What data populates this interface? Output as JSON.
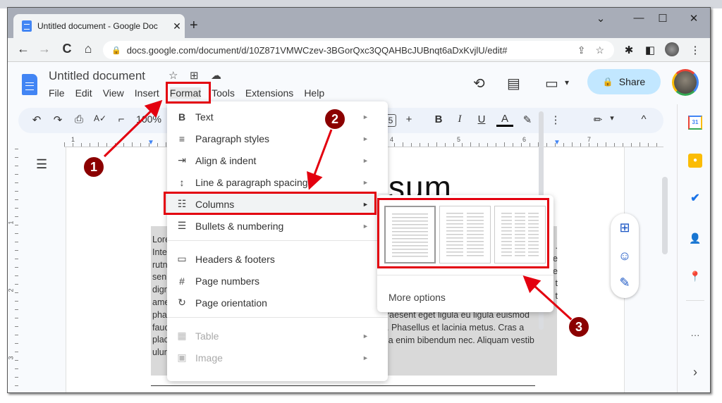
{
  "browser": {
    "tab_title": "Untitled document - Google Doc",
    "tab_close": "✕",
    "new_tab": "+",
    "window_controls": {
      "tab_search": "⌄",
      "minimize": "—",
      "maximize": "☐",
      "close": "✕"
    },
    "nav": {
      "back": "←",
      "forward": "→",
      "reload": "C",
      "home": "⌂"
    },
    "url": "docs.google.com/document/d/10Z871VMWCzev-3BGorQxc3QQAHBcJUBnqt6aDxKvjlU/edit#",
    "omnibox_icons": {
      "share": "⇪",
      "bookmark": "☆"
    },
    "extension_icons": {
      "extensions": "✱",
      "side_panel": "◧",
      "menu": "⋮"
    }
  },
  "docs": {
    "title": "Untitled document",
    "title_icons": {
      "star": "☆",
      "move": "⊞",
      "cloud": "☁"
    },
    "menu": [
      "File",
      "Edit",
      "View",
      "Insert",
      "Format",
      "Tools",
      "Extensions",
      "Help"
    ],
    "header_icons": {
      "history": "⟲",
      "comments": "▤",
      "meet": "▭",
      "meet_caret": "▾"
    },
    "share_label": "Share",
    "share_icon": "🔒",
    "toolbar": {
      "undo": "↶",
      "redo": "↷",
      "print": "⎙",
      "spellcheck": "A✓",
      "paint_format": "⌐",
      "zoom": "100%",
      "font_size": "5",
      "plus": "+",
      "bold": "B",
      "italic": "I",
      "underline": "U",
      "text_color": "A",
      "highlight": "✎",
      "more": "⋮",
      "editing_mode": "✏",
      "editing_caret": "▾",
      "collapse": "^"
    },
    "ruler_labels": [
      "1",
      "4",
      "5",
      "6",
      "7"
    ],
    "vruler_labels": [
      "1",
      "2",
      "3"
    ],
    "outline_icon": "☰",
    "heading_fragment": "sum",
    "left_text_lines": [
      "Lore",
      "Inte",
      "rutn",
      "sen",
      "digr",
      "ame",
      "pha",
      "fauc",
      "plac",
      "ulur"
    ],
    "right_col_chars": [
      ".",
      "e",
      "e",
      "t",
      "t"
    ],
    "right_text_lines": [
      "raesent eget ligula eu ligula euismod",
      ". Phasellus et lacinia metus. Cras a",
      "la enim bibendum nec. Aliquam vestib"
    ]
  },
  "format_menu": {
    "items": [
      {
        "icon": "B",
        "label": "Text",
        "submenu": true,
        "disabled": false
      },
      {
        "icon": "≡",
        "label": "Paragraph styles",
        "submenu": true,
        "disabled": false
      },
      {
        "icon": "⇥",
        "label": "Align & indent",
        "submenu": true,
        "disabled": false
      },
      {
        "icon": "↕",
        "label": "Line & paragraph spacing",
        "submenu": true,
        "disabled": false
      },
      {
        "icon": "☷",
        "label": "Columns",
        "submenu": true,
        "disabled": false,
        "highlighted": true
      },
      {
        "icon": "☰",
        "label": "Bullets & numbering",
        "submenu": true,
        "disabled": false
      },
      {
        "icon": "▭",
        "label": "Headers & footers",
        "submenu": false,
        "disabled": false
      },
      {
        "icon": "#",
        "label": "Page numbers",
        "submenu": false,
        "disabled": false
      },
      {
        "icon": "↻",
        "label": "Page orientation",
        "submenu": false,
        "disabled": false
      },
      {
        "icon": "▦",
        "label": "Table",
        "submenu": true,
        "disabled": true
      },
      {
        "icon": "▣",
        "label": "Image",
        "submenu": true,
        "disabled": true
      }
    ],
    "submenu_arrow": "►"
  },
  "columns_submenu": {
    "presets": [
      {
        "name": "one-column",
        "columns": 1,
        "selected": true
      },
      {
        "name": "two-columns",
        "columns": 2,
        "selected": false
      },
      {
        "name": "three-columns",
        "columns": 3,
        "selected": false
      }
    ],
    "more_options": "More options"
  },
  "floating_actions": {
    "add_comment": "⊞",
    "emoji": "☺",
    "suggest_edits": "✎"
  },
  "side_panel": {
    "calendar": "31",
    "keep": "●",
    "tasks": "✔",
    "contacts": "👤",
    "maps": "📍",
    "more": "···",
    "expand": "›"
  },
  "annotations": {
    "steps": [
      "1",
      "2",
      "3"
    ],
    "accent_color": "#e3000f",
    "badge_color": "#8b0000"
  }
}
